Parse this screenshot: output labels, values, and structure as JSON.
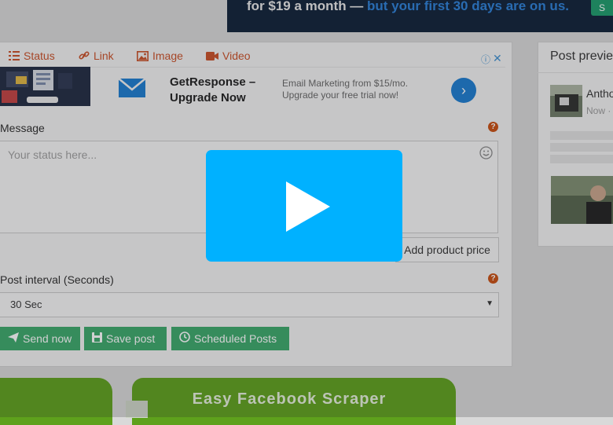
{
  "top_banner": {
    "text_prefix": "for $19 a month — ",
    "text_highlight": "but your first 30 days are on us.",
    "button_label": "S"
  },
  "composer": {
    "tabs": [
      {
        "label": "Status",
        "icon": "status-lines-icon"
      },
      {
        "label": "Link",
        "icon": "link-icon"
      },
      {
        "label": "Image",
        "icon": "image-icon"
      },
      {
        "label": "Video",
        "icon": "video-camera-icon"
      }
    ],
    "ad": {
      "title": "GetResponse – Upgrade Now",
      "description": "Email Marketing from $15/mo. Upgrade your free trial now!",
      "info_icon": "ⓘ",
      "close_icon": "✕",
      "arrow": "›"
    },
    "message_label": "Message",
    "message_placeholder": "Your status here...",
    "add_price_label": "Add product price",
    "interval_label": "Post interval (Seconds)",
    "interval_value": "30 Sec",
    "help_glyph": "?",
    "buttons": {
      "send_now": "Send now",
      "save_post": "Save post",
      "scheduled_posts": "Scheduled Posts"
    }
  },
  "preview": {
    "title": "Post previe",
    "name": "Antho",
    "time": "Now ·"
  },
  "bottom_banner": {
    "title": "Easy Facebook Scraper"
  },
  "colors": {
    "accent_orange": "#c94f26",
    "button_green": "#3aa86a",
    "play_blue": "#00b1ff",
    "banner_green": "#5ea11c"
  }
}
